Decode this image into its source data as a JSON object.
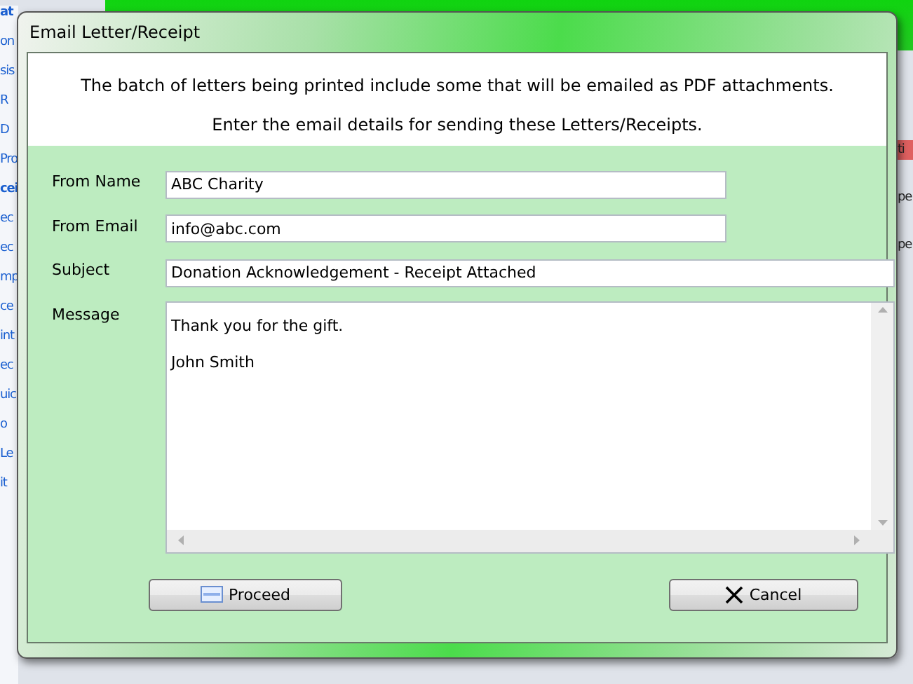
{
  "background": {
    "left_fragments": [
      {
        "text": "at",
        "bold": true
      },
      {
        "text": "on",
        "bold": false
      },
      {
        "text": "sis",
        "bold": false
      },
      {
        "text": "R",
        "bold": false
      },
      {
        "text": "D",
        "bold": false
      },
      {
        "text": "Pro",
        "bold": false
      },
      {
        "text": "cei",
        "bold": true
      },
      {
        "text": "ec",
        "bold": false
      },
      {
        "text": "ec",
        "bold": false
      },
      {
        "text": "mp",
        "bold": false
      },
      {
        "text": "ce",
        "bold": false
      },
      {
        "text": "int",
        "bold": false
      },
      {
        "text": "ec",
        "bold": false
      },
      {
        "text": "uic",
        "bold": false
      },
      {
        "text": "o",
        "bold": false
      },
      {
        "text": "Le",
        "bold": false
      },
      {
        "text": "it",
        "bold": false
      }
    ],
    "right_fragments": [
      {
        "text": "ti",
        "kind": "button"
      },
      {
        "text": "pe",
        "kind": "label"
      },
      {
        "text": "pe",
        "kind": "label"
      }
    ]
  },
  "dialog": {
    "title": "Email Letter/Receipt",
    "intro": [
      "The batch of letters being printed include some that will be emailed as PDF attachments.",
      "Enter the email details for sending these Letters/Receipts."
    ],
    "fields": [
      {
        "label": "From Name",
        "value": "ABC Charity",
        "kind": "short"
      },
      {
        "label": "From Email",
        "value": "info@abc.com",
        "kind": "short"
      },
      {
        "label": "Subject",
        "value": "Donation Acknowledgement - Receipt Attached",
        "kind": "wide"
      },
      {
        "label": "Message",
        "value": "Thank you for the gift.\n\nJohn Smith",
        "kind": "multiline"
      }
    ],
    "buttons": [
      {
        "label": "Proceed",
        "kind": "proceed"
      },
      {
        "label": "Cancel",
        "kind": "cancel"
      }
    ]
  }
}
